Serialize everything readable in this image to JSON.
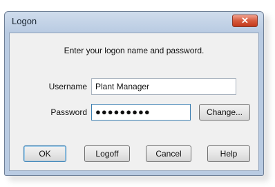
{
  "window": {
    "title": "Logon",
    "close_glyph": "✕"
  },
  "prompt": "Enter your logon name and password.",
  "username": {
    "label": "Username",
    "value": "Plant Manager"
  },
  "password": {
    "label": "Password",
    "value": "●●●●●●●●●"
  },
  "buttons": {
    "change": "Change...",
    "ok": "OK",
    "logoff": "Logoff",
    "cancel": "Cancel",
    "help": "Help"
  },
  "colors": {
    "title_bar": "#b9cbe2",
    "close_button": "#d55a3d",
    "dialog_background": "#f0f0f0",
    "focus_border": "#3c7fb1"
  }
}
